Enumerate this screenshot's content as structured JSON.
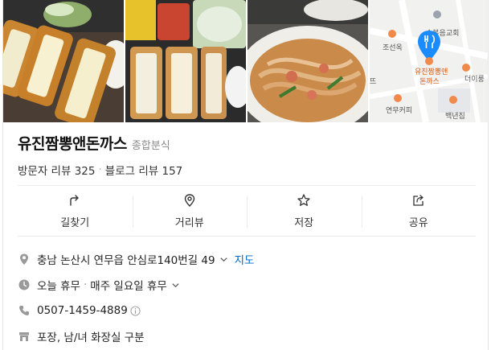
{
  "place": {
    "name": "유진짬뽕앤돈까스",
    "category": "종합분식"
  },
  "reviews": {
    "visitor_label": "방문자 리뷰",
    "visitor_count": "325",
    "blog_label": "블로그 리뷰",
    "blog_count": "157"
  },
  "map": {
    "labels": {
      "church": "순복음교회",
      "seonok": "조선옥",
      "place_line1": "유진짬뽕앤",
      "place_line2": "돈까스",
      "deorung": "더이룽",
      "yeonmu_coffee": "연무커피",
      "baeknyeon": "백년집",
      "edge": "뜨"
    }
  },
  "actions": [
    {
      "label": "길찾기",
      "icon": "directions-icon"
    },
    {
      "label": "거리뷰",
      "icon": "street-view-icon"
    },
    {
      "label": "저장",
      "icon": "star-icon"
    },
    {
      "label": "공유",
      "icon": "share-icon"
    }
  ],
  "info": {
    "address": "충남 논산시 연무읍 안심로140번길 49",
    "map_link": "지도",
    "hours_status": "오늘 휴무",
    "hours_detail": "매주 일요일 휴무",
    "phone": "0507-1459-4889",
    "amenities": "포장, 남/녀 화장실 구분"
  },
  "colors": {
    "link": "#0068c3",
    "map_pin": "#1a8cff",
    "map_poi": "#f08a4b"
  }
}
